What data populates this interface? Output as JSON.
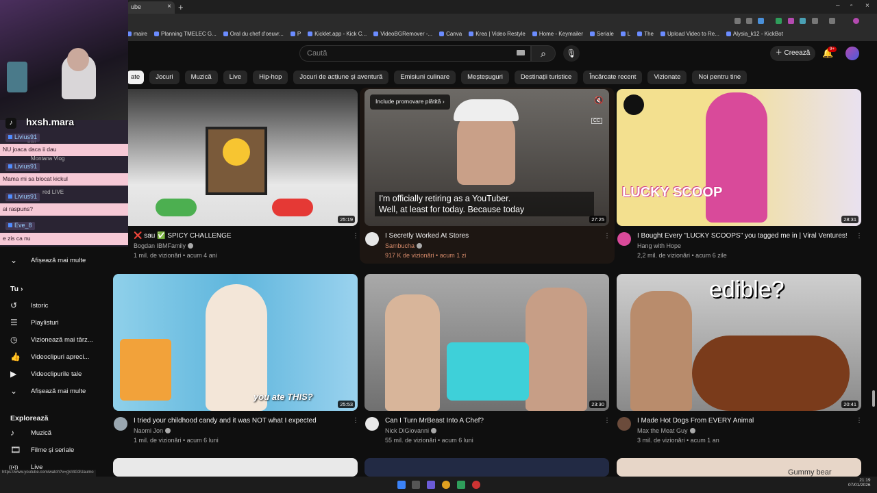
{
  "browser": {
    "tab_title": "ube",
    "new_tab": "+",
    "close_tab": "×",
    "window_controls": [
      "–",
      "▫",
      "×"
    ],
    "bookmarks": [
      "maire",
      "Planning TMELEC G...",
      "Oral du chef d'oeuvr...",
      "P",
      "Kicklet.app - Kick C...",
      "VideoBGRemover -...",
      "Canva",
      "Krea | Video Restyle",
      "Home - Keymailer",
      "Seriale",
      "L",
      "The",
      "Upload Video to Re...",
      "Alysia_k12 - KickBot"
    ]
  },
  "header": {
    "search_placeholder": "Caută",
    "create_label": "Creează",
    "notification_badge": "9+"
  },
  "chips": [
    "ate",
    "Jocuri",
    "Muzică",
    "Live",
    "Hip-hop",
    "Jocuri de acțiune și aventură",
    "Emisiuni culinare",
    "Meșteșuguri",
    "Destinații turistice",
    "Încărcate recent",
    "Vizionate",
    "Noi pentru tine"
  ],
  "videos": [
    {
      "title": "❌ sau ✅ SPICY CHALLENGE",
      "channel": "Bogdan IBMFamily",
      "meta": "1 mil. de vizionări • acum 4 ani",
      "duration": "25:19"
    },
    {
      "title": "I Secretly Worked At Stores",
      "channel": "Sambucha",
      "meta": "917 K de vizionări • acum 1 zi",
      "duration": "27:25",
      "promo": "Include promovare plătită",
      "caption_line1": "I'm officially retiring as a YouTuber.",
      "caption_line2": "Well, at least for today. Because today",
      "cc": "CC"
    },
    {
      "title": "I Bought Every \"LUCKY SCOOPS\" you tagged me in | Viral Ventures!",
      "channel": "Hang with Hope",
      "meta": "2,2 mil. de vizionări • acum 6 zile",
      "duration": "28:31",
      "thumb_text": "LUCKY SCOOP"
    },
    {
      "title": "I tried your childhood candy and it was NOT what I expected",
      "channel": "Naomi Jon",
      "meta": "1 mil. de vizionări • acum 6 luni",
      "duration": "25:53",
      "thumb_text": "you ate THIS?"
    },
    {
      "title": "Can I Turn MrBeast Into A Chef?",
      "channel": "Nick DiGiovanni",
      "meta": "55 mil. de vizionări • acum 6 luni",
      "duration": "23:30"
    },
    {
      "title": "I Made Hot Dogs From EVERY Animal",
      "channel": "Max the Meat Guy",
      "meta": "3 mil. de vizionări • acum 1 an",
      "duration": "20:41",
      "thumb_text": "edible?"
    }
  ],
  "bottom_thumb_text": "Gummy bear",
  "sidebar": {
    "show_more_1": "Afișează mai multe",
    "you_heading": "Tu",
    "you_chevron": "›",
    "items": [
      {
        "label": "Istoric",
        "icon": "history-icon",
        "glyph": "↺"
      },
      {
        "label": "Playlisturi",
        "icon": "playlist-icon",
        "glyph": "☰"
      },
      {
        "label": "Vizionează mai târz...",
        "icon": "clock-icon",
        "glyph": "◷"
      },
      {
        "label": "Videoclipuri apreci...",
        "icon": "thumb-up-icon",
        "glyph": "👍"
      },
      {
        "label": "Videoclipurile tale",
        "icon": "my-videos-icon",
        "glyph": "▶"
      }
    ],
    "show_more_2": "Afișează mai multe",
    "explore_heading": "Explorează",
    "explore_items": [
      {
        "label": "Muzică",
        "icon": "music-icon",
        "glyph": "♪"
      },
      {
        "label": "Filme și seriale",
        "icon": "film-icon",
        "glyph": "🎞"
      },
      {
        "label": "Live",
        "icon": "live-icon",
        "glyph": "((•))"
      }
    ]
  },
  "stream_overlay": {
    "tiktok_name": "hxsh.mara",
    "chat": [
      {
        "user": "Livius91",
        "msg": "NU joaca daca ii dau"
      },
      {
        "user": "Livius91",
        "msg": "Mama mi sa blocat kickul"
      },
      {
        "user": "Livius91",
        "msg": "ai raspuns?"
      },
      {
        "user": "Eve_8",
        "msg": "e zis ca nu"
      }
    ],
    "bg_fragments": [
      "ball",
      "Montana Vlog",
      "red LIVE"
    ]
  },
  "statusbar_url": "https://www.youtube.com/watch?v=gVI4G3Uaumo",
  "taskbar": {
    "time": "21:19",
    "date": "07/01/2026"
  }
}
